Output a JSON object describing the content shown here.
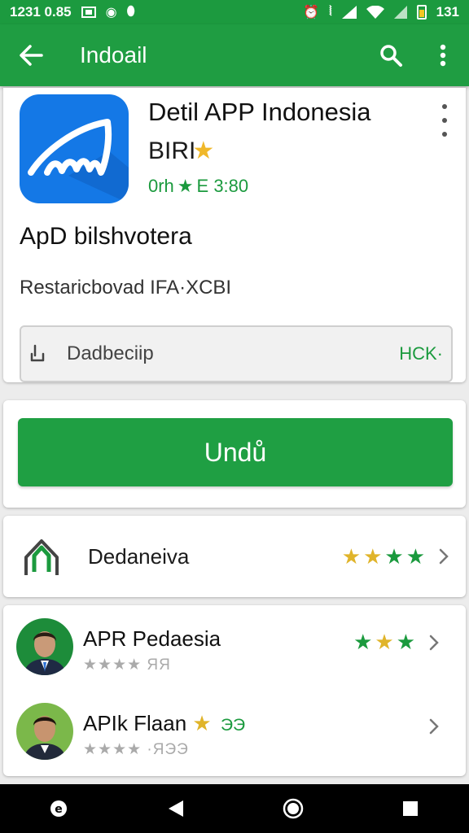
{
  "status_bar": {
    "time": "1231 0.85",
    "right_text": "131",
    "icons": [
      "notification-icon",
      "eye-icon",
      "location-icon",
      "alarm-icon",
      "vibrate-icon",
      "signal-icon",
      "wifi-icon",
      "battery-icon"
    ]
  },
  "app_bar": {
    "title": "Indoail",
    "icons": [
      "back-arrow-icon",
      "search-icon",
      "overflow-menu-icon"
    ]
  },
  "app_info": {
    "name": "Detil APP Indonesia",
    "developer": "BIRI",
    "meta_text_a": "0rh",
    "meta_text_b": "E 3:80",
    "description": "ApD bilshvotera",
    "subdescription": "Restaricbovad IFA·XCBI",
    "size_label": "Dadbeciip",
    "size_value": "HCK·"
  },
  "download": {
    "label": "Undů"
  },
  "rating": {
    "label": "Dedaneiva",
    "stars": 4
  },
  "reviews": [
    {
      "name": "APR Pedaesia",
      "stars_text": "★★★★ ЯЯ",
      "right_stars": 3,
      "extra": ""
    },
    {
      "name": "APIk Flaan",
      "stars_text": "★★★★ ·ЯЭЭ",
      "right_stars": 0,
      "extra": "ЭЭ"
    }
  ],
  "colors": {
    "primary": "#1f9d42",
    "status_bar": "#1c9a3f",
    "star_gold": "#e0b42a",
    "star_green": "#1b9a3e",
    "app_icon_blue": "#1478e6"
  }
}
